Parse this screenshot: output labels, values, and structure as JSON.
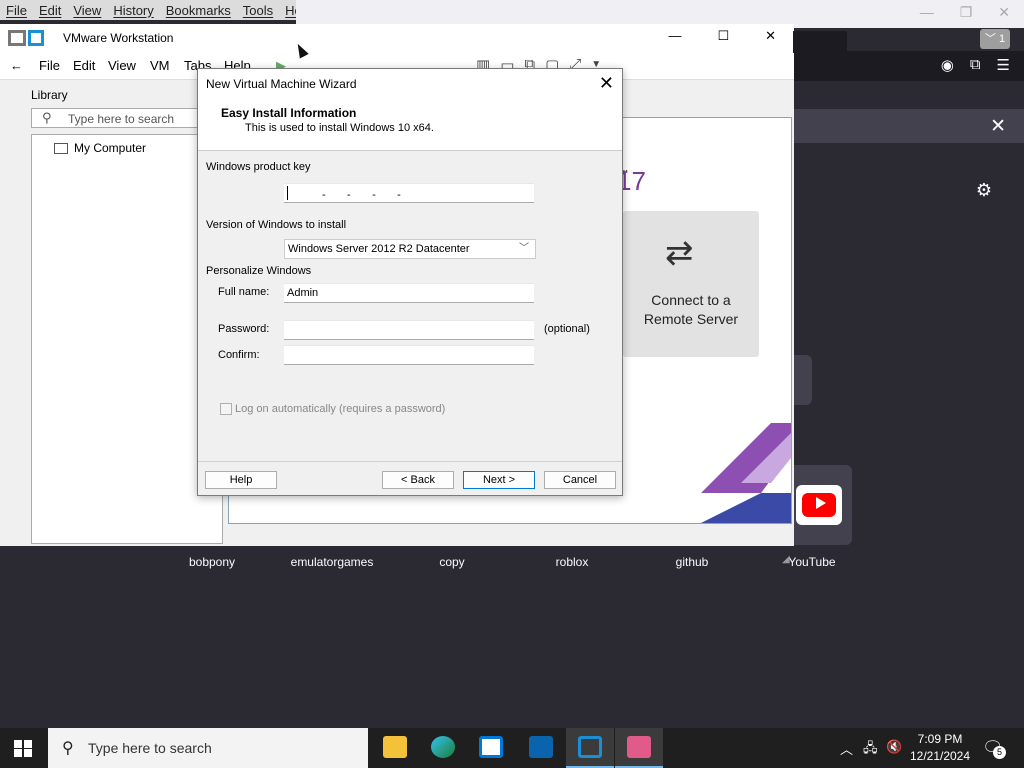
{
  "firefox": {
    "menu": [
      "File",
      "Edit",
      "View",
      "History",
      "Bookmarks",
      "Tools",
      "Help"
    ],
    "tab_count": "1",
    "shortcuts": [
      "bobpony",
      "emulatorgames",
      "copy",
      "roblox",
      "github",
      "YouTube"
    ]
  },
  "vmware": {
    "title": "VMware Workstation",
    "menu": [
      "File",
      "Edit",
      "View",
      "VM",
      "Tabs",
      "Help"
    ],
    "library": {
      "label": "Library",
      "search_placeholder": "Type here to search",
      "tree": [
        "My Computer"
      ]
    },
    "home": {
      "version": "17",
      "remote_card_label": "Connect to a Remote Server"
    }
  },
  "dialog": {
    "title": "New Virtual Machine Wizard",
    "heading": "Easy Install Information",
    "subheading": "This is used to install Windows 10 x64.",
    "product_key_label": "Windows product key",
    "product_key_value": "-       -       -       -",
    "version_label": "Version of Windows to install",
    "version_selected": "Windows Server 2012 R2 Datacenter",
    "personalize_label": "Personalize Windows",
    "fullname_label": "Full name:",
    "fullname_value": "Admin",
    "password_label": "Password:",
    "password_value": "",
    "optional_note": "(optional)",
    "confirm_label": "Confirm:",
    "confirm_value": "",
    "autologon_label": "Log on automatically (requires a password)",
    "autologon_checked": false,
    "buttons": {
      "help": "Help",
      "back": "< Back",
      "next": "Next >",
      "cancel": "Cancel"
    }
  },
  "taskbar": {
    "search_placeholder": "Type here to search",
    "apps": [
      "file-explorer",
      "edge",
      "store",
      "outlook",
      "vmware-workstation",
      "app-pink"
    ],
    "time": "7:09 PM",
    "date": "12/21/2024",
    "notification_count": "5"
  },
  "colors": {
    "accent": "#0078d7",
    "vmware_purple": "#7a3b96",
    "firefox_dark": "#1c1b22"
  }
}
